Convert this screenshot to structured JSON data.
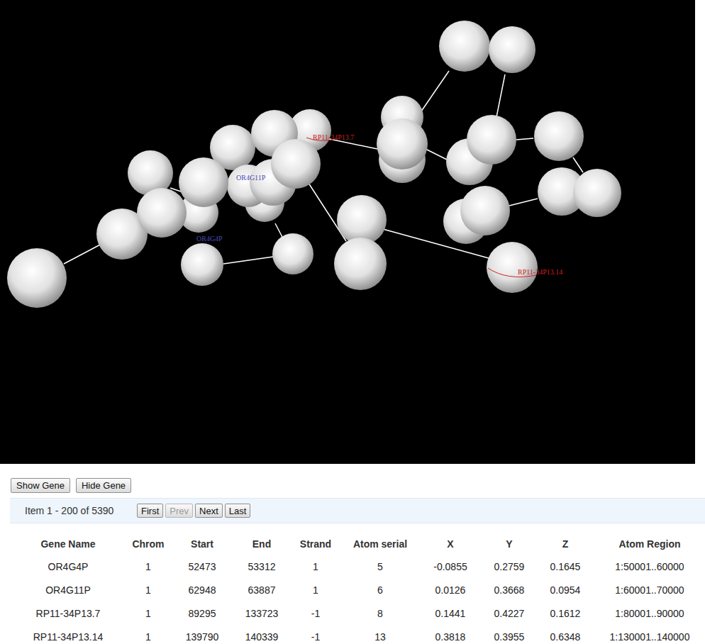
{
  "viewer": {
    "labels": [
      {
        "text": "RP11-34P13.7",
        "color": "#cc2222"
      },
      {
        "text": "OR4G11P",
        "color": "#4a4ab8"
      },
      {
        "text": "OR4G4P",
        "color": "#4a4ab8"
      },
      {
        "text": "RP11-34P13.14",
        "color": "#cc2222"
      }
    ]
  },
  "gene_buttons": [
    "Show Gene",
    "Hide Gene"
  ],
  "pager": {
    "summary": "Item 1 - 200 of 5390",
    "buttons": [
      {
        "label": "First",
        "disabled": false
      },
      {
        "label": "Prev",
        "disabled": true
      },
      {
        "label": "Next",
        "disabled": false
      },
      {
        "label": "Last",
        "disabled": false
      }
    ]
  },
  "table": {
    "columns": [
      "Gene Name",
      "Chrom",
      "Start",
      "End",
      "Strand",
      "Atom serial",
      "X",
      "Y",
      "Z",
      "Atom Region"
    ],
    "rows": [
      [
        "OR4G4P",
        "1",
        "52473",
        "53312",
        "1",
        "5",
        "-0.0855",
        "0.2759",
        "0.1645",
        "1:50001..60000"
      ],
      [
        "OR4G11P",
        "1",
        "62948",
        "63887",
        "1",
        "6",
        "0.0126",
        "0.3668",
        "0.0954",
        "1:60001..70000"
      ],
      [
        "RP11-34P13.7",
        "1",
        "89295",
        "133723",
        "-1",
        "8",
        "0.1441",
        "0.4227",
        "0.1612",
        "1:80001..90000"
      ],
      [
        "RP11-34P13.14",
        "1",
        "139790",
        "140339",
        "-1",
        "13",
        "0.3818",
        "0.3955",
        "0.6348",
        "1:130001..140000"
      ]
    ]
  }
}
